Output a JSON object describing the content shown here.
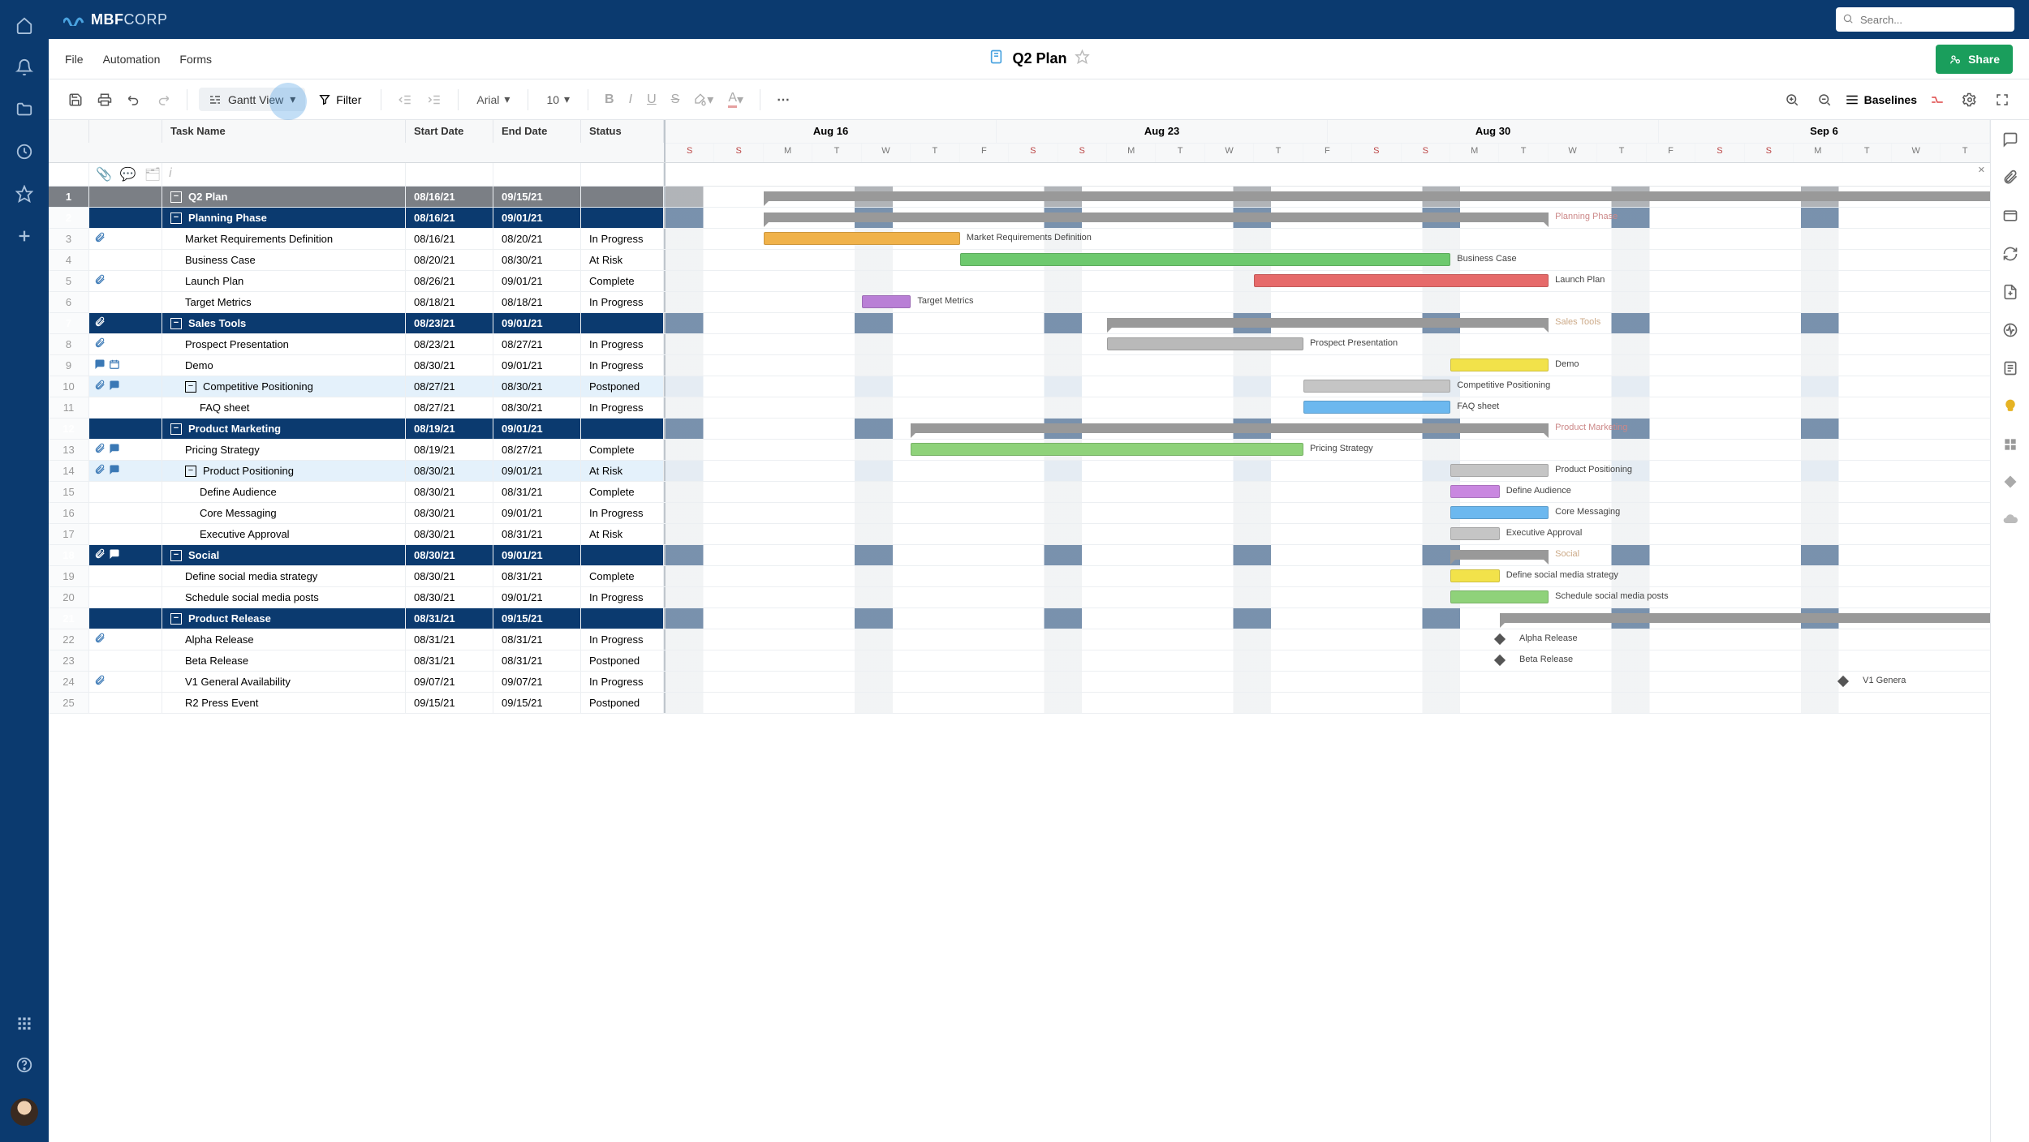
{
  "brand": {
    "name_a": "MBF",
    "name_b": "CORP"
  },
  "search": {
    "placeholder": "Search..."
  },
  "menu": {
    "file": "File",
    "automation": "Automation",
    "forms": "Forms"
  },
  "doc": {
    "title": "Q2 Plan"
  },
  "share_label": "Share",
  "toolbar": {
    "view_label": "Gantt View",
    "filter_label": "Filter",
    "font": "Arial",
    "size": "10",
    "baselines_label": "Baselines"
  },
  "columns": {
    "task": "Task Name",
    "start": "Start Date",
    "end": "End Date",
    "status": "Status"
  },
  "timeline": {
    "weeks": [
      "Aug 16",
      "Aug 23",
      "Aug 30",
      "Sep 6"
    ],
    "days": [
      "S",
      "S",
      "M",
      "T",
      "W",
      "T",
      "F",
      "S",
      "S",
      "M",
      "T",
      "W",
      "T",
      "F",
      "S",
      "S",
      "M",
      "T",
      "W",
      "T",
      "F",
      "S",
      "S",
      "M",
      "T",
      "W",
      "T"
    ],
    "weekend_idx": [
      0,
      1,
      7,
      8,
      14,
      15,
      21,
      22
    ],
    "start_day_index": -2,
    "total_days": 27
  },
  "rows": [
    {
      "n": 1,
      "type": "title",
      "task": "Q2 Plan",
      "start": "08/16/21",
      "end": "09/15/21",
      "bar": {
        "kind": "summary",
        "from": 0,
        "to": 30,
        "label": ""
      }
    },
    {
      "n": 2,
      "type": "section",
      "task": "Planning Phase",
      "start": "08/16/21",
      "end": "09/01/21",
      "bar": {
        "kind": "summary",
        "from": 0,
        "to": 16,
        "label": "Planning Phase",
        "labelColor": "#c88"
      }
    },
    {
      "n": 3,
      "type": "task",
      "indent": 1,
      "task": "Market Requirements Definition",
      "start": "08/16/21",
      "end": "08/20/21",
      "status": "In Progress",
      "icons": [
        "clip"
      ],
      "bar": {
        "kind": "bar",
        "from": 0,
        "to": 4,
        "color": "#f0b24a",
        "label": "Market Requirements Definition"
      }
    },
    {
      "n": 4,
      "type": "task",
      "indent": 1,
      "task": "Business Case",
      "start": "08/20/21",
      "end": "08/30/21",
      "status": "At Risk",
      "bar": {
        "kind": "bar",
        "from": 4,
        "to": 14,
        "color": "#6ec96e",
        "label": "Business Case"
      }
    },
    {
      "n": 5,
      "type": "task",
      "indent": 1,
      "task": "Launch Plan",
      "start": "08/26/21",
      "end": "09/01/21",
      "status": "Complete",
      "icons": [
        "clip"
      ],
      "bar": {
        "kind": "bar",
        "from": 10,
        "to": 16,
        "color": "#e66a6a",
        "label": "Launch Plan"
      }
    },
    {
      "n": 6,
      "type": "task",
      "indent": 1,
      "task": "Target Metrics",
      "start": "08/18/21",
      "end": "08/18/21",
      "status": "In Progress",
      "bar": {
        "kind": "bar",
        "from": 2,
        "to": 3,
        "color": "#b97fd6",
        "label": "Target Metrics"
      }
    },
    {
      "n": 7,
      "type": "section",
      "task": "Sales Tools",
      "start": "08/23/21",
      "end": "09/01/21",
      "icons": [
        "clip"
      ],
      "bar": {
        "kind": "summary",
        "from": 7,
        "to": 16,
        "label": "Sales Tools",
        "labelColor": "#ca8"
      }
    },
    {
      "n": 8,
      "type": "task",
      "indent": 1,
      "task": "Prospect Presentation",
      "start": "08/23/21",
      "end": "08/27/21",
      "status": "In Progress",
      "icons": [
        "clip"
      ],
      "bar": {
        "kind": "bar",
        "from": 7,
        "to": 11,
        "color": "#b9b9b9",
        "label": "Prospect Presentation"
      }
    },
    {
      "n": 9,
      "type": "task",
      "indent": 1,
      "task": "Demo",
      "start": "08/30/21",
      "end": "09/01/21",
      "status": "In Progress",
      "icons": [
        "chat",
        "cal"
      ],
      "bar": {
        "kind": "bar",
        "from": 14,
        "to": 16,
        "color": "#f2e24a",
        "label": "Demo"
      }
    },
    {
      "n": 10,
      "type": "task",
      "indent": 1,
      "task": "Competitive Positioning",
      "start": "08/27/21",
      "end": "08/30/21",
      "status": "Postponed",
      "icons": [
        "clip",
        "chat"
      ],
      "selected": true,
      "collapse": true,
      "bar": {
        "kind": "bar",
        "from": 11,
        "to": 14,
        "color": "#c5c5c5",
        "label": "Competitive Positioning"
      }
    },
    {
      "n": 11,
      "type": "task",
      "indent": 2,
      "task": "FAQ sheet",
      "start": "08/27/21",
      "end": "08/30/21",
      "status": "In Progress",
      "bar": {
        "kind": "bar",
        "from": 11,
        "to": 14,
        "color": "#6cb8ef",
        "label": "FAQ sheet"
      }
    },
    {
      "n": 12,
      "type": "section",
      "task": "Product Marketing",
      "start": "08/19/21",
      "end": "09/01/21",
      "bar": {
        "kind": "summary",
        "from": 3,
        "to": 16,
        "label": "Product Marketing",
        "labelColor": "#c88"
      }
    },
    {
      "n": 13,
      "type": "task",
      "indent": 1,
      "task": "Pricing Strategy",
      "start": "08/19/21",
      "end": "08/27/21",
      "status": "Complete",
      "icons": [
        "clip",
        "chat"
      ],
      "bar": {
        "kind": "bar",
        "from": 3,
        "to": 11,
        "color": "#8fd27a",
        "label": "Pricing Strategy"
      }
    },
    {
      "n": 14,
      "type": "task",
      "indent": 1,
      "task": "Product Positioning",
      "start": "08/30/21",
      "end": "09/01/21",
      "status": "At Risk",
      "icons": [
        "clip",
        "chat"
      ],
      "selected": true,
      "collapse": true,
      "bar": {
        "kind": "bar",
        "from": 14,
        "to": 16,
        "color": "#c5c5c5",
        "label": "Product Positioning"
      }
    },
    {
      "n": 15,
      "type": "task",
      "indent": 2,
      "task": "Define Audience",
      "start": "08/30/21",
      "end": "08/31/21",
      "status": "Complete",
      "bar": {
        "kind": "bar",
        "from": 14,
        "to": 15,
        "color": "#c987e0",
        "label": "Define Audience"
      }
    },
    {
      "n": 16,
      "type": "task",
      "indent": 2,
      "task": "Core Messaging",
      "start": "08/30/21",
      "end": "09/01/21",
      "status": "In Progress",
      "bar": {
        "kind": "bar",
        "from": 14,
        "to": 16,
        "color": "#6cb8ef",
        "label": "Core Messaging"
      }
    },
    {
      "n": 17,
      "type": "task",
      "indent": 2,
      "task": "Executive Approval",
      "start": "08/30/21",
      "end": "08/31/21",
      "status": "At Risk",
      "bar": {
        "kind": "bar",
        "from": 14,
        "to": 15,
        "color": "#c5c5c5",
        "label": "Executive Approval"
      }
    },
    {
      "n": 18,
      "type": "section",
      "task": "Social",
      "start": "08/30/21",
      "end": "09/01/21",
      "icons": [
        "clip",
        "chat"
      ],
      "bar": {
        "kind": "summary",
        "from": 14,
        "to": 16,
        "label": "Social",
        "labelColor": "#ca8"
      }
    },
    {
      "n": 19,
      "type": "task",
      "indent": 1,
      "task": "Define social media strategy",
      "start": "08/30/21",
      "end": "08/31/21",
      "status": "Complete",
      "bar": {
        "kind": "bar",
        "from": 14,
        "to": 15,
        "color": "#f2e24a",
        "label": "Define social media strategy"
      }
    },
    {
      "n": 20,
      "type": "task",
      "indent": 1,
      "task": "Schedule social media posts",
      "start": "08/30/21",
      "end": "09/01/21",
      "status": "In Progress",
      "bar": {
        "kind": "bar",
        "from": 14,
        "to": 16,
        "color": "#8fd27a",
        "label": "Schedule social media posts"
      }
    },
    {
      "n": 21,
      "type": "section",
      "task": "Product Release",
      "start": "08/31/21",
      "end": "09/15/21",
      "bar": {
        "kind": "summary",
        "from": 15,
        "to": 30,
        "label": ""
      }
    },
    {
      "n": 22,
      "type": "task",
      "indent": 1,
      "task": "Alpha Release",
      "start": "08/31/21",
      "end": "08/31/21",
      "status": "In Progress",
      "icons": [
        "clip"
      ],
      "bar": {
        "kind": "milestone",
        "at": 15,
        "label": "Alpha Release"
      }
    },
    {
      "n": 23,
      "type": "task",
      "indent": 1,
      "task": "Beta Release",
      "start": "08/31/21",
      "end": "08/31/21",
      "status": "Postponed",
      "bar": {
        "kind": "milestone",
        "at": 15,
        "label": "Beta Release"
      }
    },
    {
      "n": 24,
      "type": "task",
      "indent": 1,
      "task": "V1 General Availability",
      "start": "09/07/21",
      "end": "09/07/21",
      "status": "In Progress",
      "icons": [
        "clip"
      ],
      "bar": {
        "kind": "milestone",
        "at": 22,
        "label": "V1 Genera"
      }
    },
    {
      "n": 25,
      "type": "task",
      "indent": 1,
      "task": "R2 Press Event",
      "start": "09/15/21",
      "end": "09/15/21",
      "status": "Postponed",
      "bar": {}
    }
  ]
}
